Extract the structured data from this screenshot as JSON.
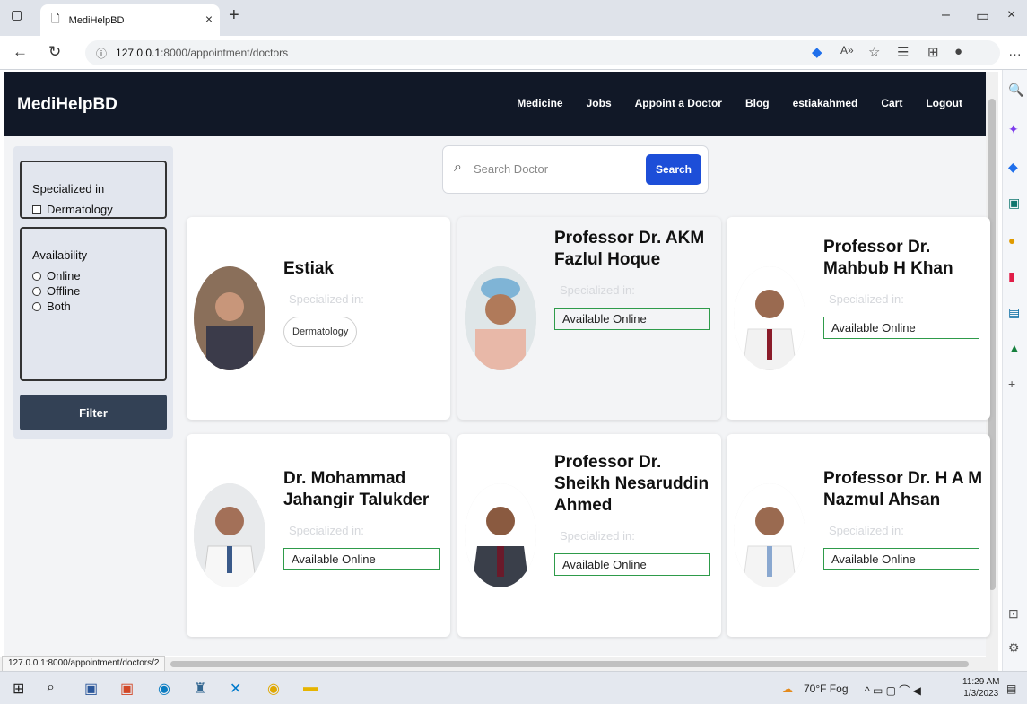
{
  "browser": {
    "tab_title": "MediHelpBD",
    "url_host": "127.0.0.1",
    "url_path": ":8000/appointment/doctors",
    "status_url": "127.0.0.1:8000/appointment/doctors/2"
  },
  "navbar": {
    "brand": "MediHelpBD",
    "items": [
      "Medicine",
      "Jobs",
      "Appoint a Doctor",
      "Blog",
      "estiakahmed",
      "Cart",
      "Logout"
    ]
  },
  "filters": {
    "specialized_title": "Specialized in",
    "specialties": [
      "Dermatology"
    ],
    "availability_title": "Availability",
    "availability_options": [
      "Online",
      "Offline",
      "Both"
    ],
    "filter_button": "Filter"
  },
  "search": {
    "placeholder": "Search Doctor",
    "button": "Search"
  },
  "doctors": [
    {
      "name": "Estiak",
      "specialized_label": "Specialized in:",
      "specialty": "Dermatology",
      "availability": ""
    },
    {
      "name": "Professor Dr. AKM Fazlul Hoque",
      "specialized_label": "Specialized in:",
      "specialty": "",
      "availability": "Available Online"
    },
    {
      "name": "Professor Dr. Mahbub H Khan",
      "specialized_label": "Specialized in:",
      "specialty": "",
      "availability": "Available Online"
    },
    {
      "name": "Dr. Mohammad Jahangir Talukder",
      "specialized_label": "Specialized in:",
      "specialty": "",
      "availability": "Available Online"
    },
    {
      "name": "Professor Dr. Sheikh Nesaruddin Ahmed",
      "specialized_label": "Specialized in:",
      "specialty": "",
      "availability": "Available Online"
    },
    {
      "name": "Professor Dr. H A M Nazmul Ahsan",
      "specialized_label": "Specialized in:",
      "specialty": "",
      "availability": "Available Online"
    }
  ],
  "taskbar": {
    "weather": "70°F Fog",
    "time": "11:29 AM",
    "date": "1/3/2023"
  }
}
